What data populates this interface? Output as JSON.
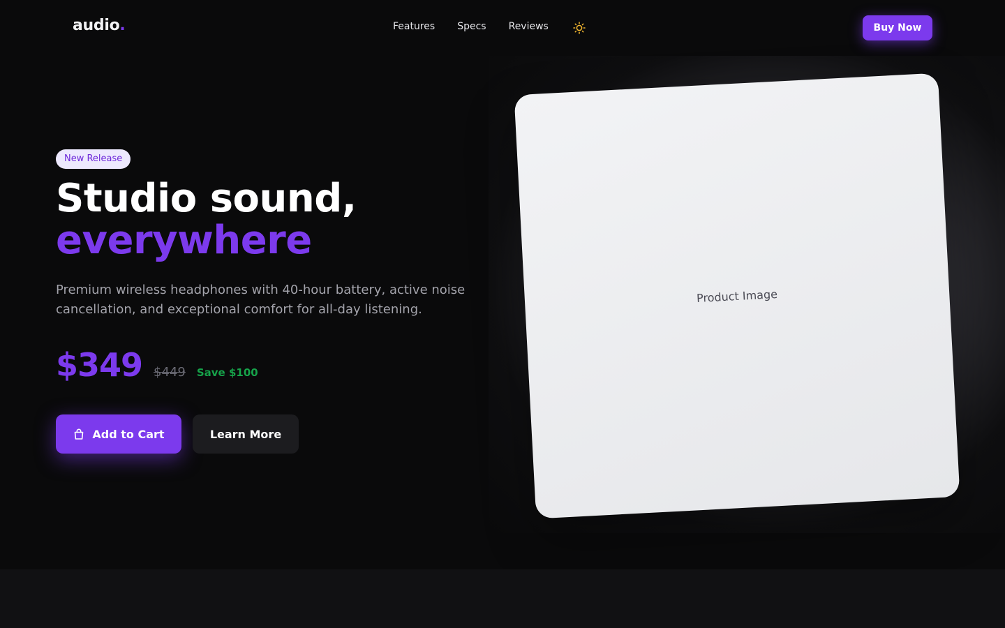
{
  "brand": {
    "logo_text": "audio",
    "logo_dot": ".",
    "accent_color": "#7c3aed"
  },
  "nav": {
    "links": [
      {
        "label": "Features"
      },
      {
        "label": "Specs"
      },
      {
        "label": "Reviews"
      }
    ],
    "theme_icon": "sun-icon",
    "cta_label": "Buy Now"
  },
  "hero": {
    "badge": "New Release",
    "headline_line1": "Studio sound,",
    "headline_line2": "everywhere",
    "description": "Premium wireless headphones with 40-hour battery, active noise cancellation, and exceptional comfort for all-day listening.",
    "price": "$349",
    "old_price": "$449",
    "savings": "Save $100",
    "add_to_cart_label": "Add to Cart",
    "add_to_cart_icon": "shopping-bag-icon",
    "learn_more_label": "Learn More",
    "product_image_label": "Product Image",
    "savings_color": "#16a34a"
  }
}
